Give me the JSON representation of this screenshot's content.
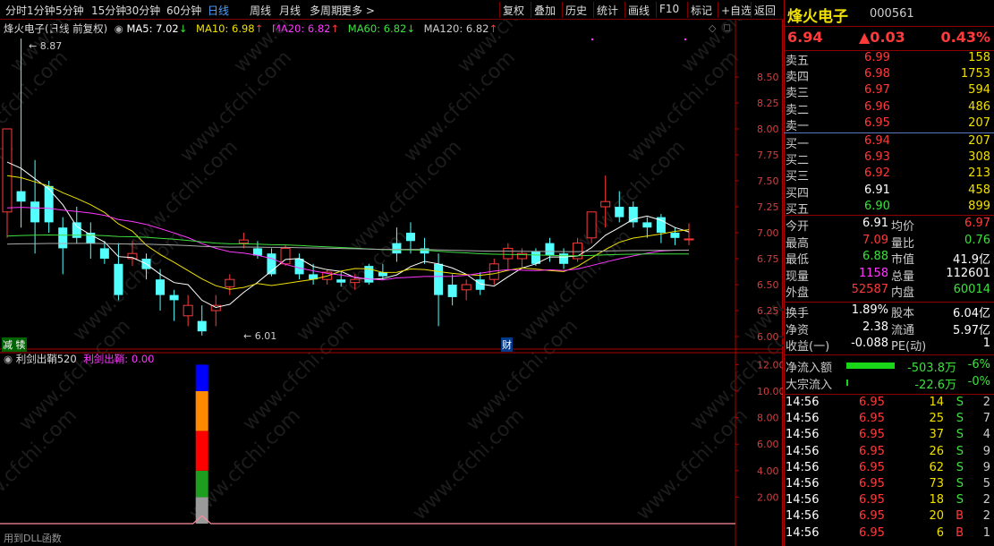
{
  "toolbar": {
    "periods": [
      "分时",
      "1分钟",
      "5分钟",
      "15分钟",
      "30分钟",
      "60分钟",
      "日线",
      "周线",
      "月线",
      "多周期",
      "更多 >"
    ],
    "active": "日线",
    "actions": [
      "复权",
      "叠加",
      "历史",
      "统计",
      "画线",
      "F10",
      "标记",
      "+自选",
      "返回"
    ]
  },
  "indicator_line": {
    "stock": "烽火电子",
    "mode": "(日线 前复权)",
    "ma5": "MA5: 7.02",
    "ma10": "MA10: 6.98",
    "ma20": "MA20: 6.82",
    "ma60": "MA60: 6.82",
    "ma120": "MA120: 6.82",
    "ma5_arrow": "↓",
    "ma10_arrow": "↑",
    "ma20_arrow": "↑",
    "ma60_arrow": "↓",
    "ma120_arrow": "↑"
  },
  "price_axis": [
    "8.50",
    "8.25",
    "8.00",
    "7.75",
    "7.50",
    "7.25",
    "7.00",
    "6.75",
    "6.50",
    "6.25",
    "6.00"
  ],
  "high_label": "8.87",
  "low_label": "6.01",
  "markers": {
    "left": "减 犊",
    "mid": "财"
  },
  "sub_indicator": {
    "name": "利剑出鞘520",
    "value_label": "利剑出鞘: 0.00"
  },
  "sub_axis": [
    "12.00",
    "10.00",
    "8.00",
    "6.00",
    "4.00",
    "2.00"
  ],
  "footer_text": "用到DLL函数",
  "watermark": "www.cfchi.com",
  "chart_data": {
    "type": "candlestick",
    "ylim": [
      5.95,
      8.87
    ],
    "candles": [
      {
        "o": 7.2,
        "h": 8.0,
        "l": 6.95,
        "c": 8.0
      },
      {
        "o": 7.4,
        "h": 8.87,
        "l": 7.05,
        "c": 7.3
      },
      {
        "o": 7.3,
        "h": 7.7,
        "l": 6.8,
        "c": 7.1
      },
      {
        "o": 7.45,
        "h": 7.5,
        "l": 7.0,
        "c": 7.1
      },
      {
        "o": 7.05,
        "h": 7.15,
        "l": 6.6,
        "c": 6.85
      },
      {
        "o": 7.1,
        "h": 7.25,
        "l": 6.9,
        "c": 6.95
      },
      {
        "o": 7.0,
        "h": 7.1,
        "l": 6.75,
        "c": 6.9
      },
      {
        "o": 6.85,
        "h": 6.92,
        "l": 6.7,
        "c": 6.75
      },
      {
        "o": 6.7,
        "h": 6.9,
        "l": 6.35,
        "c": 6.4
      },
      {
        "o": 6.75,
        "h": 6.92,
        "l": 6.68,
        "c": 6.8
      },
      {
        "o": 6.75,
        "h": 6.8,
        "l": 6.55,
        "c": 6.65
      },
      {
        "o": 6.55,
        "h": 6.65,
        "l": 6.25,
        "c": 6.4
      },
      {
        "o": 6.4,
        "h": 6.45,
        "l": 6.15,
        "c": 6.35
      },
      {
        "o": 6.2,
        "h": 6.4,
        "l": 6.1,
        "c": 6.3
      },
      {
        "o": 6.15,
        "h": 6.3,
        "l": 6.01,
        "c": 6.05
      },
      {
        "o": 6.25,
        "h": 6.4,
        "l": 6.1,
        "c": 6.3
      },
      {
        "o": 6.48,
        "h": 6.6,
        "l": 6.4,
        "c": 6.55
      },
      {
        "o": 6.9,
        "h": 7.0,
        "l": 6.85,
        "c": 6.93
      },
      {
        "o": 6.85,
        "h": 6.92,
        "l": 6.75,
        "c": 6.78
      },
      {
        "o": 6.8,
        "h": 6.85,
        "l": 6.58,
        "c": 6.6
      },
      {
        "o": 6.7,
        "h": 6.88,
        "l": 6.68,
        "c": 6.85
      },
      {
        "o": 6.75,
        "h": 6.8,
        "l": 6.55,
        "c": 6.6
      },
      {
        "o": 6.6,
        "h": 6.7,
        "l": 6.5,
        "c": 6.55
      },
      {
        "o": 6.55,
        "h": 6.65,
        "l": 6.5,
        "c": 6.62
      },
      {
        "o": 6.55,
        "h": 6.62,
        "l": 6.48,
        "c": 6.52
      },
      {
        "o": 6.52,
        "h": 6.6,
        "l": 6.45,
        "c": 6.55
      },
      {
        "o": 6.68,
        "h": 6.7,
        "l": 6.5,
        "c": 6.52
      },
      {
        "o": 6.62,
        "h": 6.7,
        "l": 6.55,
        "c": 6.58
      },
      {
        "o": 6.9,
        "h": 7.05,
        "l": 6.72,
        "c": 6.8
      },
      {
        "o": 7.0,
        "h": 7.1,
        "l": 6.8,
        "c": 6.92
      },
      {
        "o": 6.85,
        "h": 6.95,
        "l": 6.7,
        "c": 6.8
      },
      {
        "o": 6.7,
        "h": 6.8,
        "l": 6.1,
        "c": 6.4
      },
      {
        "o": 6.5,
        "h": 6.6,
        "l": 6.3,
        "c": 6.38
      },
      {
        "o": 6.45,
        "h": 6.55,
        "l": 6.35,
        "c": 6.5
      },
      {
        "o": 6.55,
        "h": 6.62,
        "l": 6.4,
        "c": 6.45
      },
      {
        "o": 6.55,
        "h": 6.75,
        "l": 6.5,
        "c": 6.7
      },
      {
        "o": 6.75,
        "h": 6.9,
        "l": 6.65,
        "c": 6.85
      },
      {
        "o": 6.75,
        "h": 6.85,
        "l": 6.65,
        "c": 6.8
      },
      {
        "o": 6.82,
        "h": 6.85,
        "l": 6.68,
        "c": 6.7
      },
      {
        "o": 6.9,
        "h": 6.95,
        "l": 6.72,
        "c": 6.78
      },
      {
        "o": 6.8,
        "h": 6.85,
        "l": 6.65,
        "c": 6.7
      },
      {
        "o": 6.75,
        "h": 6.95,
        "l": 6.72,
        "c": 6.9
      },
      {
        "o": 6.95,
        "h": 7.2,
        "l": 6.9,
        "c": 7.2
      },
      {
        "o": 7.25,
        "h": 7.55,
        "l": 7.05,
        "c": 7.3
      },
      {
        "o": 7.25,
        "h": 7.4,
        "l": 7.1,
        "c": 7.15
      },
      {
        "o": 7.25,
        "h": 7.3,
        "l": 7.05,
        "c": 7.1
      },
      {
        "o": 7.1,
        "h": 7.15,
        "l": 6.95,
        "c": 7.05
      },
      {
        "o": 7.15,
        "h": 7.18,
        "l": 6.9,
        "c": 7.0
      },
      {
        "o": 7.0,
        "h": 7.05,
        "l": 6.88,
        "c": 6.95
      },
      {
        "o": 6.94,
        "h": 7.09,
        "l": 6.88,
        "c": 6.94
      }
    ],
    "sub_bars": [
      {
        "segments": [
          {
            "v": 2.0,
            "color": "#9a9a9a"
          },
          {
            "v": 2.0,
            "color": "#1e9e1e"
          },
          {
            "v": 3.0,
            "color": "#ff0000"
          },
          {
            "v": 3.0,
            "color": "#ff8a00"
          },
          {
            "v": 2.0,
            "color": "#0000ff"
          }
        ]
      }
    ],
    "sub_ylim": [
      0,
      13.2
    ]
  },
  "right_panel": {
    "name": "烽火电子",
    "code": "000561",
    "price": "6.94",
    "change": "▲0.03",
    "pct": "0.43%",
    "asks": [
      [
        "卖五",
        "6.99",
        "158"
      ],
      [
        "卖四",
        "6.98",
        "1753"
      ],
      [
        "卖三",
        "6.97",
        "594"
      ],
      [
        "卖二",
        "6.96",
        "486"
      ],
      [
        "卖一",
        "6.95",
        "207"
      ]
    ],
    "bids": [
      [
        "买一",
        "6.94",
        "207"
      ],
      [
        "买二",
        "6.93",
        "308"
      ],
      [
        "买三",
        "6.92",
        "213"
      ],
      [
        "买四",
        "6.91",
        "458"
      ],
      [
        "买五",
        "6.90",
        "899"
      ]
    ],
    "stats": [
      [
        "今开",
        "6.91",
        "均价",
        "6.97"
      ],
      [
        "最高",
        "7.09",
        "量比",
        "0.76"
      ],
      [
        "最低",
        "6.88",
        "市值",
        "41.9亿"
      ],
      [
        "现量",
        "1158",
        "总量",
        "112601"
      ],
      [
        "外盘",
        "52587",
        "内盘",
        "60014"
      ]
    ],
    "stats2": [
      [
        "换手",
        "1.89%",
        "股本",
        "6.04亿"
      ],
      [
        "净资",
        "2.38",
        "流通",
        "5.97亿"
      ],
      [
        "收益(一)",
        "-0.088",
        "PE(动)",
        "1"
      ]
    ],
    "flows": [
      [
        "净流入额",
        "-503.8万",
        "-6%"
      ],
      [
        "大宗流入",
        "-22.6万",
        "-0%"
      ]
    ],
    "ticks": [
      [
        "14:56",
        "6.95",
        "14",
        "S",
        "2"
      ],
      [
        "14:56",
        "6.95",
        "25",
        "S",
        "7"
      ],
      [
        "14:56",
        "6.95",
        "37",
        "S",
        "4"
      ],
      [
        "14:56",
        "6.95",
        "26",
        "S",
        "9"
      ],
      [
        "14:56",
        "6.95",
        "62",
        "S",
        "9"
      ],
      [
        "14:56",
        "6.95",
        "73",
        "S",
        "5"
      ],
      [
        "14:56",
        "6.95",
        "18",
        "S",
        "2"
      ],
      [
        "14:56",
        "6.95",
        "20",
        "B",
        "2"
      ],
      [
        "14:56",
        "6.95",
        "6",
        "B",
        "1"
      ]
    ]
  }
}
